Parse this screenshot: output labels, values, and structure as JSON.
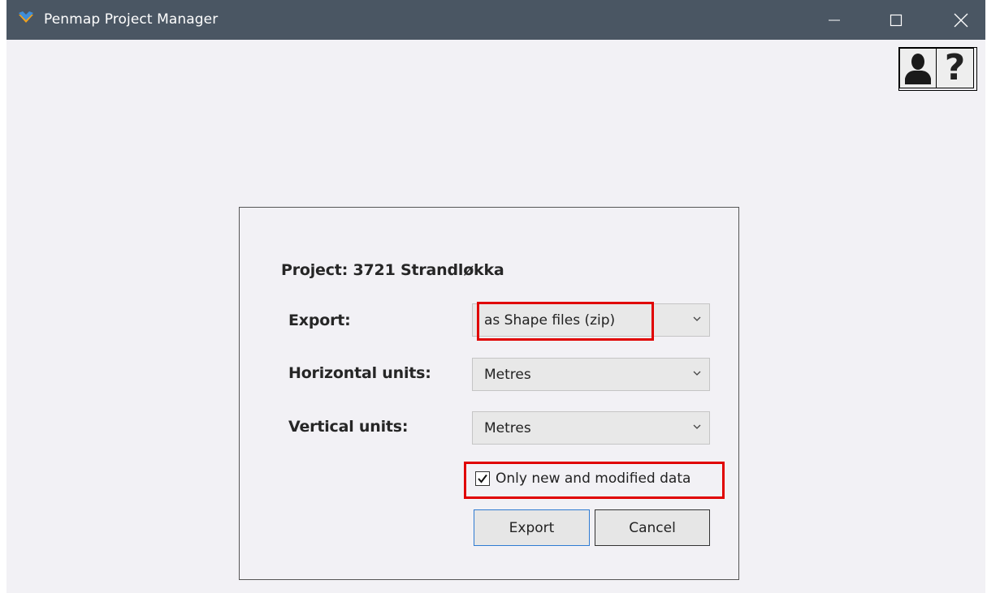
{
  "window": {
    "title": "Penmap Project Manager",
    "colors": {
      "titlebar": "#4a5663",
      "background": "#f2f1f5",
      "highlight": "#e00000",
      "focus": "#2f7bd2"
    },
    "controls": {
      "minimize_icon": "minimize-icon",
      "maximize_icon": "maximize-icon",
      "close_icon": "close-icon"
    }
  },
  "toolbar": {
    "user_icon": "user-icon",
    "help_label": "?"
  },
  "dialog": {
    "project_title": "Project: 3721 Strandløkka",
    "export": {
      "label": "Export:",
      "value": "as Shape files (zip)"
    },
    "horizontal_units": {
      "label": "Horizontal units:",
      "value": "Metres"
    },
    "vertical_units": {
      "label": "Vertical units:",
      "value": "Metres"
    },
    "only_new_checkbox": {
      "label": "Only new and modified data",
      "checked": true
    },
    "buttons": {
      "export_label": "Export",
      "cancel_label": "Cancel"
    }
  }
}
